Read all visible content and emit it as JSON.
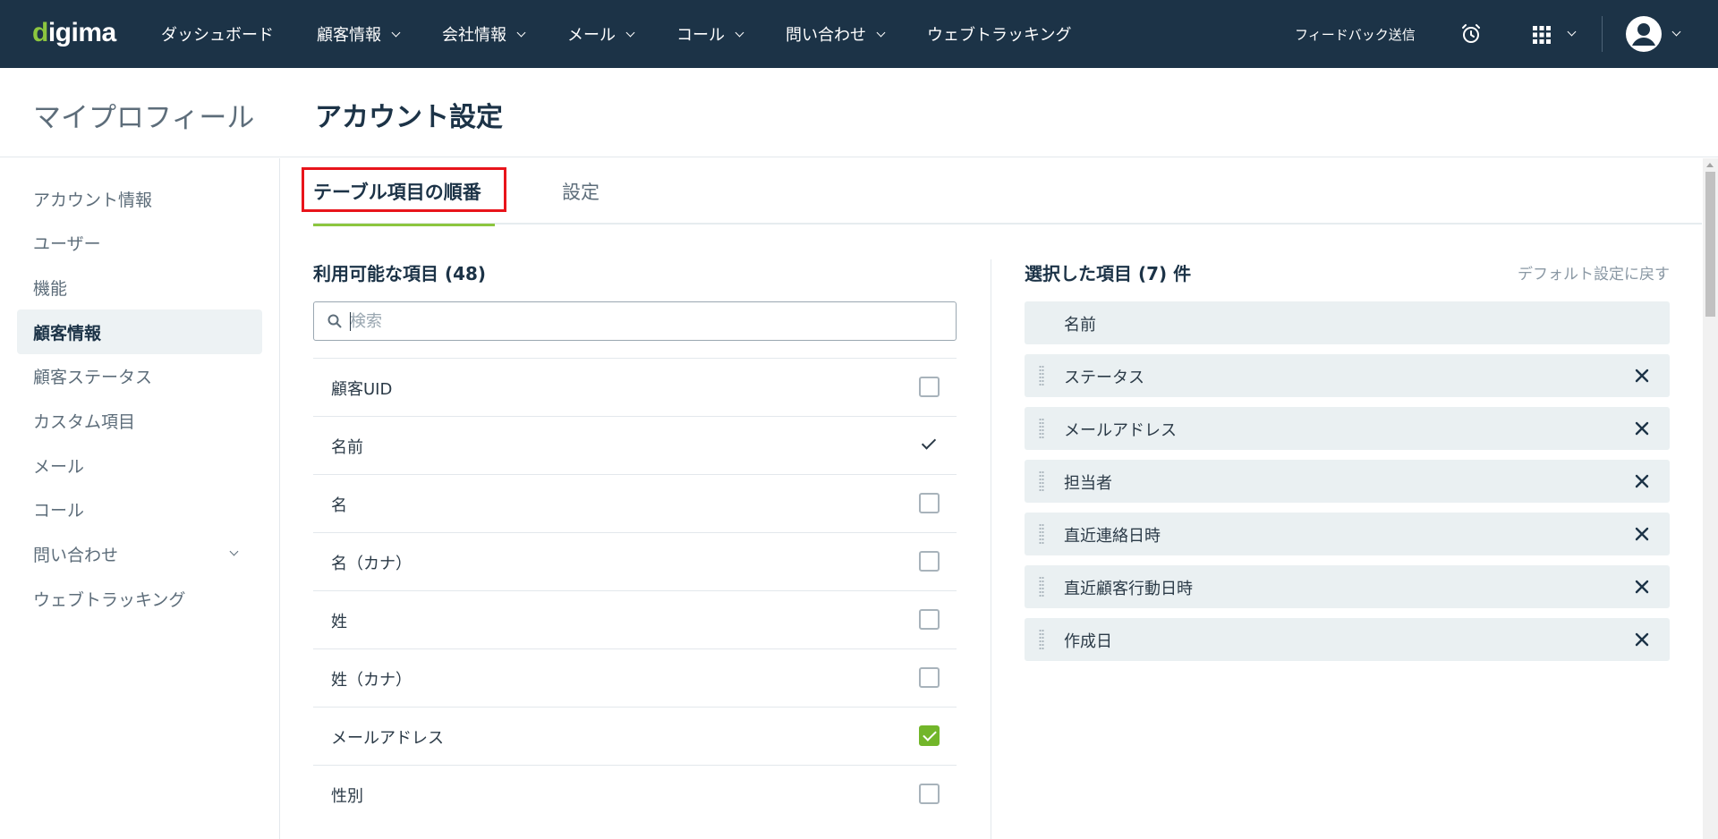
{
  "brand": {
    "logo_prefix": "d",
    "logo_rest": "igima",
    "accent": "#8cc63f",
    "nav_bg": "#1c3347"
  },
  "topnav": {
    "items": [
      {
        "label": "ダッシュボード",
        "has_dropdown": false
      },
      {
        "label": "顧客情報",
        "has_dropdown": true
      },
      {
        "label": "会社情報",
        "has_dropdown": true
      },
      {
        "label": "メール",
        "has_dropdown": true
      },
      {
        "label": "コール",
        "has_dropdown": true
      },
      {
        "label": "問い合わせ",
        "has_dropdown": true
      },
      {
        "label": "ウェブトラッキング",
        "has_dropdown": false
      }
    ],
    "feedback": "フィードバック送信",
    "icons": [
      "alarm-clock-icon",
      "apps-grid-icon",
      "user-avatar-icon"
    ]
  },
  "header": {
    "profile_title": "マイプロフィール",
    "page_title": "アカウント設定"
  },
  "sidebar": {
    "items": [
      {
        "label": "アカウント情報",
        "active": false
      },
      {
        "label": "ユーザー",
        "active": false
      },
      {
        "label": "機能",
        "active": false
      },
      {
        "label": "顧客情報",
        "active": true
      },
      {
        "label": "顧客ステータス",
        "active": false
      },
      {
        "label": "カスタム項目",
        "active": false
      },
      {
        "label": "メール",
        "active": false
      },
      {
        "label": "コール",
        "active": false
      },
      {
        "label": "問い合わせ",
        "active": false,
        "has_dropdown": true
      },
      {
        "label": "ウェブトラッキング",
        "active": false
      }
    ]
  },
  "tabs": {
    "active": "テーブル項目の順番",
    "other": "設定",
    "highlight_color": "#e8141b"
  },
  "available": {
    "title": "利用可能な項目 (48)",
    "search_placeholder": "検索",
    "items": [
      {
        "label": "顧客UID",
        "state": "unchecked"
      },
      {
        "label": "名前",
        "state": "locked"
      },
      {
        "label": "名",
        "state": "unchecked"
      },
      {
        "label": "名（カナ）",
        "state": "unchecked"
      },
      {
        "label": "姓",
        "state": "unchecked"
      },
      {
        "label": "姓（カナ）",
        "state": "unchecked"
      },
      {
        "label": "メールアドレス",
        "state": "checked"
      },
      {
        "label": "性別",
        "state": "unchecked"
      }
    ]
  },
  "selected": {
    "title": "選択した項目 (7) 件",
    "reset_link": "デフォルト設定に戻す",
    "items": [
      {
        "label": "名前",
        "fixed": true
      },
      {
        "label": "ステータス",
        "fixed": false
      },
      {
        "label": "メールアドレス",
        "fixed": false
      },
      {
        "label": "担当者",
        "fixed": false
      },
      {
        "label": "直近連絡日時",
        "fixed": false
      },
      {
        "label": "直近顧客行動日時",
        "fixed": false
      },
      {
        "label": "作成日",
        "fixed": false
      }
    ]
  }
}
